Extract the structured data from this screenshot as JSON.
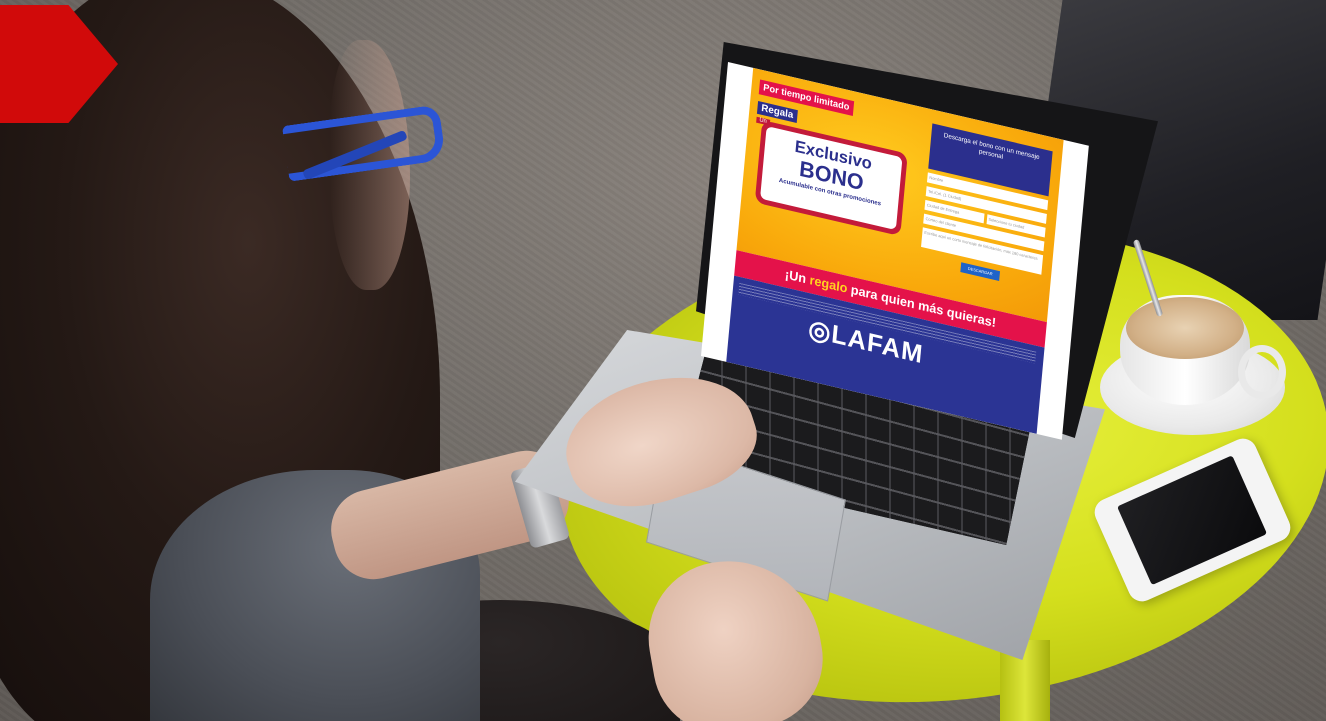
{
  "screen": {
    "badge_time": "Por tiempo limitado",
    "badge_gift": "Regala",
    "badge_un": "Un",
    "title_line1": "Exclusivo",
    "title_line2": "BONO",
    "title_subtext": "Acumulable con otras promociones",
    "form_heading": "Descarga el bono con un mensaje personal",
    "form_fields": [
      "Nombre",
      "Tel./Cel. (1 Ciudad)",
      "Ciudad de Entrega",
      "Seleccione tu ciudad",
      "Correo del cliente",
      "Escribe aquí un corto mensaje de felicitación, máx 180 caracteres"
    ],
    "download_button": "DESCARGAR",
    "tagline_pre": "¡Un ",
    "tagline_highlight": "regalo",
    "tagline_post": " para quien más quieras!",
    "logo": "LAFAM"
  },
  "colors": {
    "accent_red": "#d10a0a",
    "promo_yellow": "#f9a90b",
    "brand_blue": "#2b2f8d",
    "brand_pink": "#e4124a",
    "table_yellow": "#d4df1d"
  }
}
